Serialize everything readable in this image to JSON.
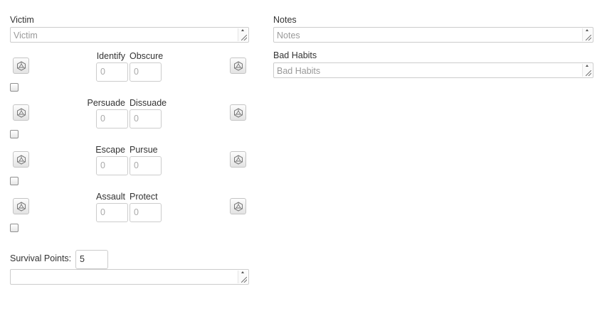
{
  "victim": {
    "label": "Victim",
    "placeholder": "Victim"
  },
  "notes": {
    "label": "Notes",
    "placeholder": "Notes"
  },
  "bad_habits": {
    "label": "Bad Habits",
    "placeholder": "Bad Habits"
  },
  "stat_rows": [
    {
      "left_label": "Identify",
      "right_label": "Obscure",
      "left_value": "0",
      "right_value": "0"
    },
    {
      "left_label": "Persuade",
      "right_label": "Dissuade",
      "left_value": "0",
      "right_value": "0"
    },
    {
      "left_label": "Escape",
      "right_label": "Pursue",
      "left_value": "0",
      "right_value": "0"
    },
    {
      "left_label": "Assault",
      "right_label": "Protect",
      "left_value": "0",
      "right_value": "0"
    }
  ],
  "survival": {
    "label": "Survival Points:",
    "value": "5"
  },
  "icons": {
    "roll_left": "d20-dice-icon",
    "roll_right": "d20-dice-icon"
  }
}
